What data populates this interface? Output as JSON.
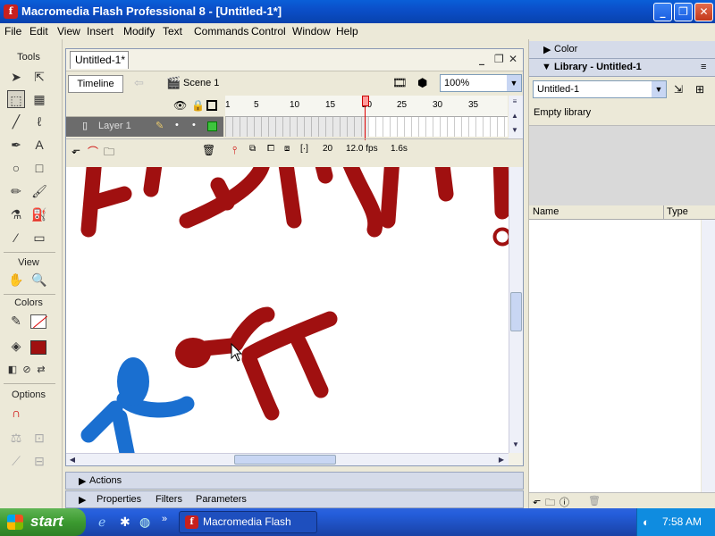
{
  "window": {
    "title": "Macromedia Flash Professional 8 - [Untitled-1*]"
  },
  "menu": [
    "File",
    "Edit",
    "View",
    "Insert",
    "Modify",
    "Text",
    "Commands",
    "Control",
    "Window",
    "Help"
  ],
  "tools": {
    "title": "Tools",
    "view": "View",
    "colors": "Colors",
    "options": "Options"
  },
  "document": {
    "tab": "Untitled-1*",
    "timeline_button": "Timeline",
    "scene": "Scene 1",
    "zoom": "100%"
  },
  "timeline": {
    "layer": "Layer 1",
    "ruler": [
      "1",
      "5",
      "10",
      "15",
      "20",
      "25",
      "30",
      "35"
    ],
    "current_frame": "20",
    "fps": "12.0 fps",
    "time": "1.6s"
  },
  "stage": {
    "text": "FIGHT!"
  },
  "panels": {
    "actions": "Actions",
    "properties": "Properties",
    "filters": "Filters",
    "parameters": "Parameters"
  },
  "right": {
    "color": "Color",
    "library_title": "Library - Untitled-1",
    "library_doc": "Untitled-1",
    "empty": "Empty library",
    "col_name": "Name",
    "col_type": "Type"
  },
  "taskbar": {
    "start": "start",
    "task": "Macromedia Flash Pro...",
    "clock": "7:58 AM"
  },
  "colors": {
    "title_blue": "#0b4fc9",
    "fighter_red": "#a01010",
    "fighter_blue": "#1a6fd0"
  }
}
